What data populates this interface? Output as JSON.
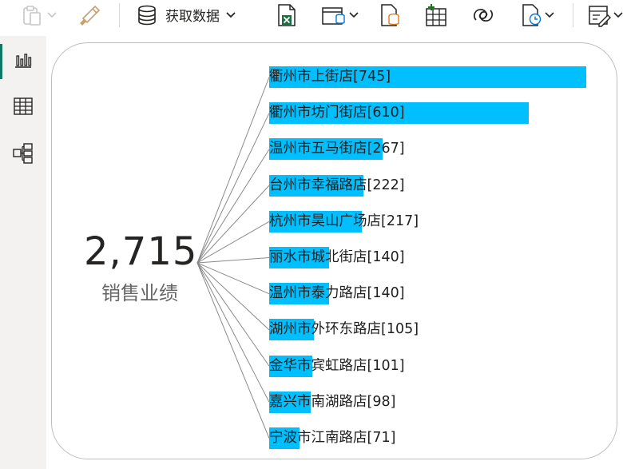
{
  "toolbar": {
    "get_data_label": "获取数据",
    "icons": [
      "clipboard-icon",
      "chevron-down-icon",
      "format-painter-icon",
      "database-icon",
      "chevron-down-icon",
      "excel-icon",
      "data-hub-icon",
      "chevron-down-icon",
      "sql-server-icon",
      "enter-data-icon",
      "dataverse-icon",
      "recent-sources-icon",
      "chevron-down-icon",
      "transform-data-icon",
      "chevron-down-icon"
    ]
  },
  "rail": {
    "items": [
      "report-view-icon",
      "table-view-icon",
      "model-view-icon"
    ],
    "active": "report-view-icon",
    "accent_color": "#117865"
  },
  "visual": {
    "total_value": "2,715",
    "total_label": "销售业绩",
    "bar_color": "#00bfff"
  },
  "chart_data": {
    "type": "bar",
    "orientation": "horizontal",
    "categories": [
      "衢州市上街店",
      "衢州市坊门街店",
      "温州市五马街店",
      "台州市幸福路店",
      "杭州市昊山广场店",
      "丽水市城北街店",
      "温州市泰力路店",
      "湖州市外环东路店",
      "金华市宾虹路店",
      "嘉兴市南湖路店",
      "宁波市江南路店"
    ],
    "values": [
      745,
      610,
      267,
      222,
      217,
      140,
      140,
      105,
      101,
      98,
      71
    ],
    "labels": [
      "衢州市上街店[745]",
      "衢州市坊门街店[610]",
      "温州市五马街店[267]",
      "台州市幸福路店[222]",
      "杭州市昊山广场店[217]",
      "丽水市城北街店[140]",
      "温州市泰力路店[140]",
      "湖州市外环东路店[105]",
      "金华市宾虹路店[101]",
      "嘉兴市南湖路店[98]",
      "宁波市江南路店[71]"
    ],
    "total": 2715,
    "total_label": "销售业绩",
    "xlim": [
      0,
      745
    ]
  }
}
